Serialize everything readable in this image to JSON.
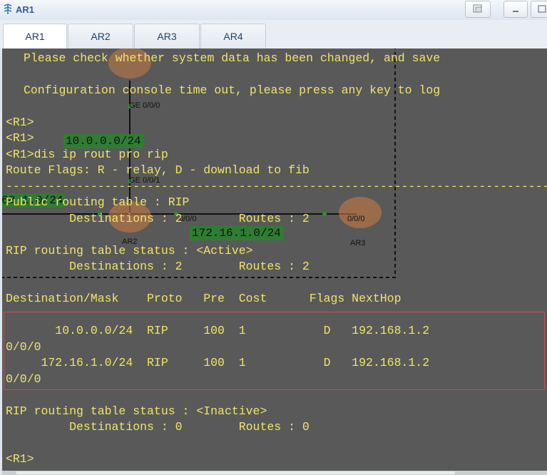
{
  "window": {
    "title": "AR1"
  },
  "tabs": [
    {
      "label": "AR1"
    },
    {
      "label": "AR2"
    },
    {
      "label": "AR3"
    },
    {
      "label": "AR4"
    }
  ],
  "terminal": {
    "lines": [
      "Please check whether system data has been changed, and save",
      "",
      "Configuration console time out, please press any key to log",
      "",
      "<R1>",
      "<R1>",
      "<R1>dis ip rout pro rip",
      "Route Flags: R - relay, D - download to fib",
      "------------------------------------------------------------------------------",
      "Public routing table : RIP",
      "         Destinations : 2        Routes : 2",
      "",
      "RIP routing table status : <Active>",
      "         Destinations : 2        Routes : 2",
      "",
      "Destination/Mask    Proto   Pre  Cost      Flags NextHop",
      "",
      "       10.0.0.0/24  RIP     100  1           D   192.168.1.2",
      "0/0/0",
      "     172.16.1.0/24  RIP     100  1           D   192.168.1.2",
      "0/0/0",
      "",
      "RIP routing table status : <Inactive>",
      "         Destinations : 0        Routes : 0",
      "",
      "<R1>"
    ]
  },
  "topology": {
    "router_ar2_label": "AR2",
    "router_ar3_label": "AR3",
    "port_ge000": "GE 0/0/0",
    "port_ge001": "GE 0/0/1",
    "port_ar2_left": "0/0/0",
    "port_ar3_left": "0/0/0",
    "net_10": "10.0.0.0/24",
    "net_172": "172.16.1.0/24",
    "net_192_partial": "68.1.0/24"
  }
}
